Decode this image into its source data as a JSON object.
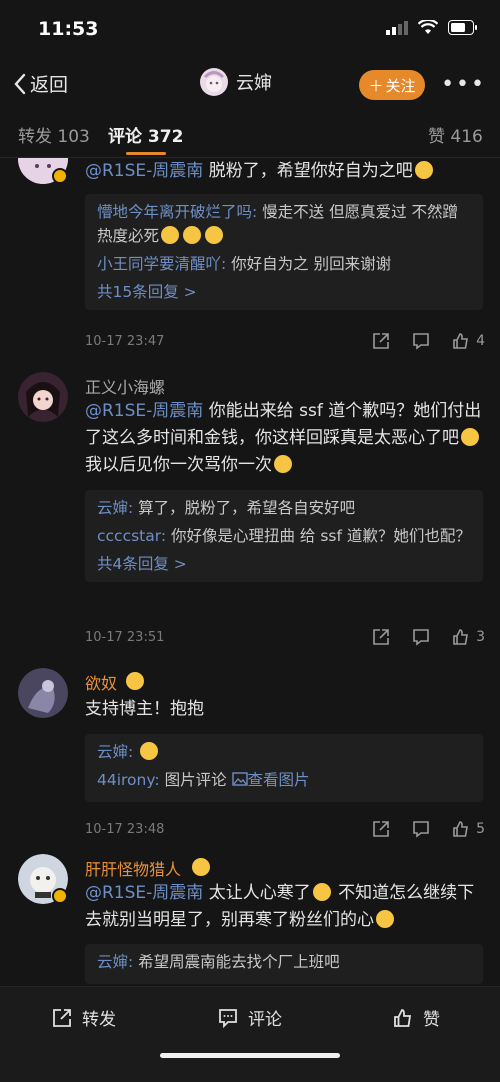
{
  "status": {
    "time": "11:53"
  },
  "nav": {
    "back_label": "返回",
    "title": "云婶",
    "follow_label": "关注",
    "more": "•••"
  },
  "tabs": [
    {
      "label": "转发 103"
    },
    {
      "label": "评论 372"
    },
    {
      "label": "赞 416"
    }
  ],
  "comments": [
    {
      "mention": "@R1SE-周震南",
      "text": " 脱粉了，希望你好自为之吧",
      "replies": [
        {
          "name": "懵地今年离开破烂了吗:",
          "text": " 慢走不送 但愿真爱过 不然蹭热度必死"
        },
        {
          "name": "小王同学要清醒吖:",
          "text": " 你好自为之  别回来谢谢"
        }
      ],
      "more_replies": "共15条回复 >",
      "date": "10-17 23:47",
      "likes": "4"
    },
    {
      "author": "正义小海螺",
      "mention": "@R1SE-周震南",
      "text": " 你能出来给 ssf 道个歉吗？她们付出了这么多时间和金钱，你这样回踩真是太恶心了吧",
      "text2": " 我以后见你一次骂你一次",
      "replies": [
        {
          "name": "云婶:",
          "text": " 算了，脱粉了，希望各自安好吧"
        },
        {
          "name": "ccccstar:",
          "text": " 你好像是心理扭曲 给 ssf 道歉？她们也配？"
        }
      ],
      "more_replies": "共4条回复 >",
      "date": "10-17 23:51",
      "likes": "3"
    },
    {
      "author": "欲奴",
      "text": "支持博主！抱抱",
      "replies": [
        {
          "name": "云婶:",
          "text": " "
        },
        {
          "name": "44irony:",
          "text": " 图片评论 ",
          "link": "查看图片"
        }
      ],
      "date": "10-17 23:48",
      "likes": "5"
    },
    {
      "author": "肝肝怪物猎人",
      "mention": "@R1SE-周震南",
      "text": " 太让人心寒了",
      "text2": " 不知道怎么继续下去就别当明星了，别再寒了粉丝们的心",
      "replies": [
        {
          "name": "云婶:",
          "text": " 希望周震南能去找个厂上班吧"
        }
      ]
    }
  ],
  "bottom": {
    "repost": "转发",
    "comment": "评论",
    "like": "赞"
  },
  "colors": {
    "accent": "#e6892a",
    "link": "#6e8fc6",
    "background": "#151515"
  }
}
